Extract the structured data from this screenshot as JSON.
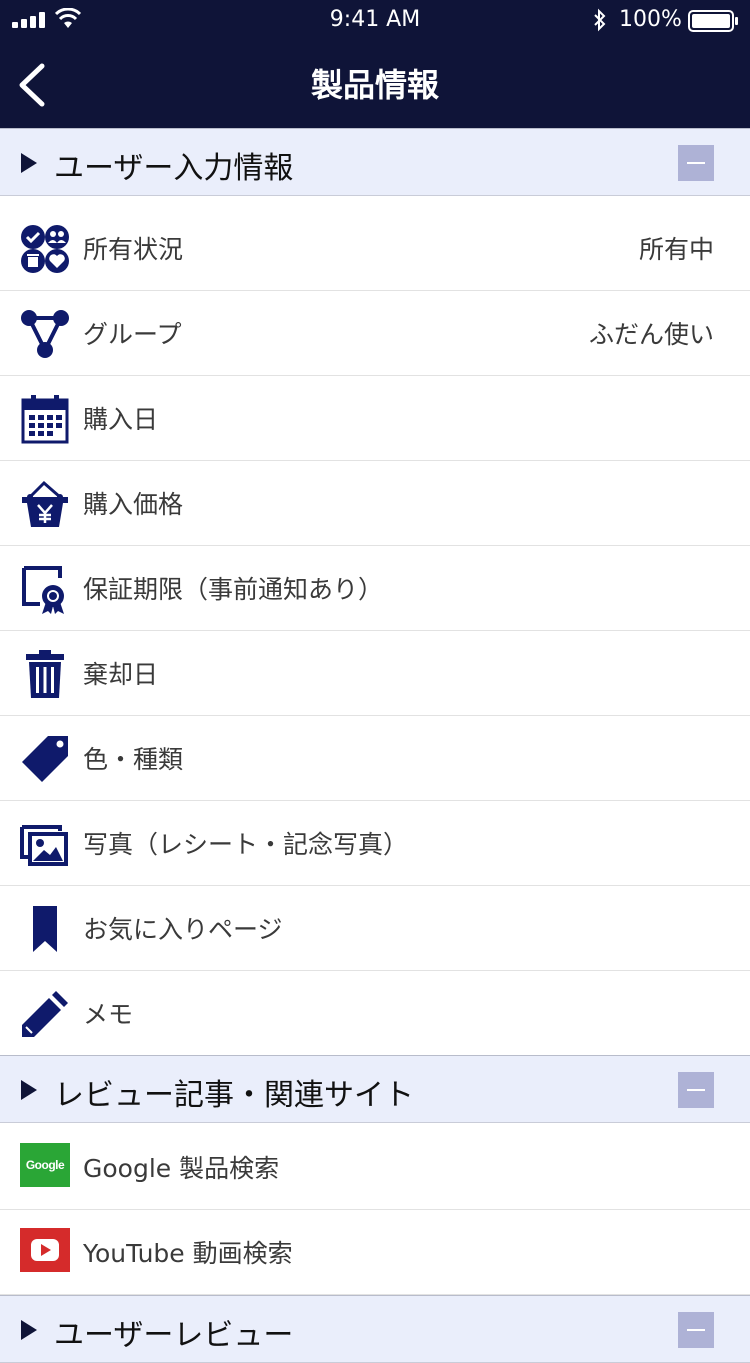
{
  "status_bar": {
    "time": "9:41 AM",
    "battery": "100%"
  },
  "nav": {
    "title": "製品情報"
  },
  "sections": [
    {
      "label": "ユーザー入力情報"
    },
    {
      "label": "レビュー記事・関連サイト"
    },
    {
      "label": "ユーザーレビュー"
    }
  ],
  "user_info": {
    "items": [
      {
        "icon": "status-icon",
        "label": "所有状況",
        "value": "所有中"
      },
      {
        "icon": "group-icon",
        "label": "グループ",
        "value": "ふだん使い"
      },
      {
        "icon": "calendar-icon",
        "label": "購入日",
        "value": ""
      },
      {
        "icon": "yen-basket-icon",
        "label": "購入価格",
        "value": ""
      },
      {
        "icon": "certificate-icon",
        "label": "保証期限（事前通知あり）",
        "value": ""
      },
      {
        "icon": "trash-icon",
        "label": "棄却日",
        "value": ""
      },
      {
        "icon": "tag-icon",
        "label": "色・種類",
        "value": ""
      },
      {
        "icon": "photo-icon",
        "label": "写真（レシート・記念写真）",
        "value": ""
      },
      {
        "icon": "bookmark-icon",
        "label": "お気に入りページ",
        "value": ""
      },
      {
        "icon": "pencil-icon",
        "label": "メモ",
        "value": ""
      }
    ]
  },
  "review_links": [
    {
      "icon": "google-logo",
      "logo_text": "Google",
      "label": "Google 製品検索"
    },
    {
      "icon": "youtube-logo",
      "label": "YouTube 動画検索"
    }
  ],
  "colors": {
    "nav_bg": "#0f1438",
    "icon": "#0f1a6b",
    "section_bg": "#eaeefb",
    "collapse": "#aeb2d6",
    "google": "#2aa636",
    "youtube": "#d52b2b"
  }
}
